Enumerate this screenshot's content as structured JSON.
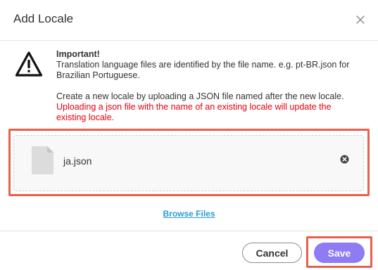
{
  "dialog": {
    "title": "Add Locale",
    "close_icon": "close-icon"
  },
  "notice": {
    "icon": "warning-icon",
    "heading": "Important!",
    "line1": "Translation language files are identified by the file name. e.g. pt-BR.json for",
    "line2": "Brazilian Portuguese.",
    "line3": "Create a new locale by uploading a JSON file named after the new locale.",
    "warning_line1": "Uploading a json file with the name of an existing locale will update the",
    "warning_line2": "existing locale.",
    "warning_color": "#e3000f"
  },
  "dropzone": {
    "file_icon": "file-icon",
    "file_name": "ja.json",
    "remove_icon": "remove-file-icon"
  },
  "browse_label": "Browse Files",
  "footer": {
    "cancel_label": "Cancel",
    "save_label": "Save"
  },
  "colors": {
    "accent": "#8f7bf4",
    "link": "#2b9bd3",
    "highlight": "#e8604c"
  }
}
